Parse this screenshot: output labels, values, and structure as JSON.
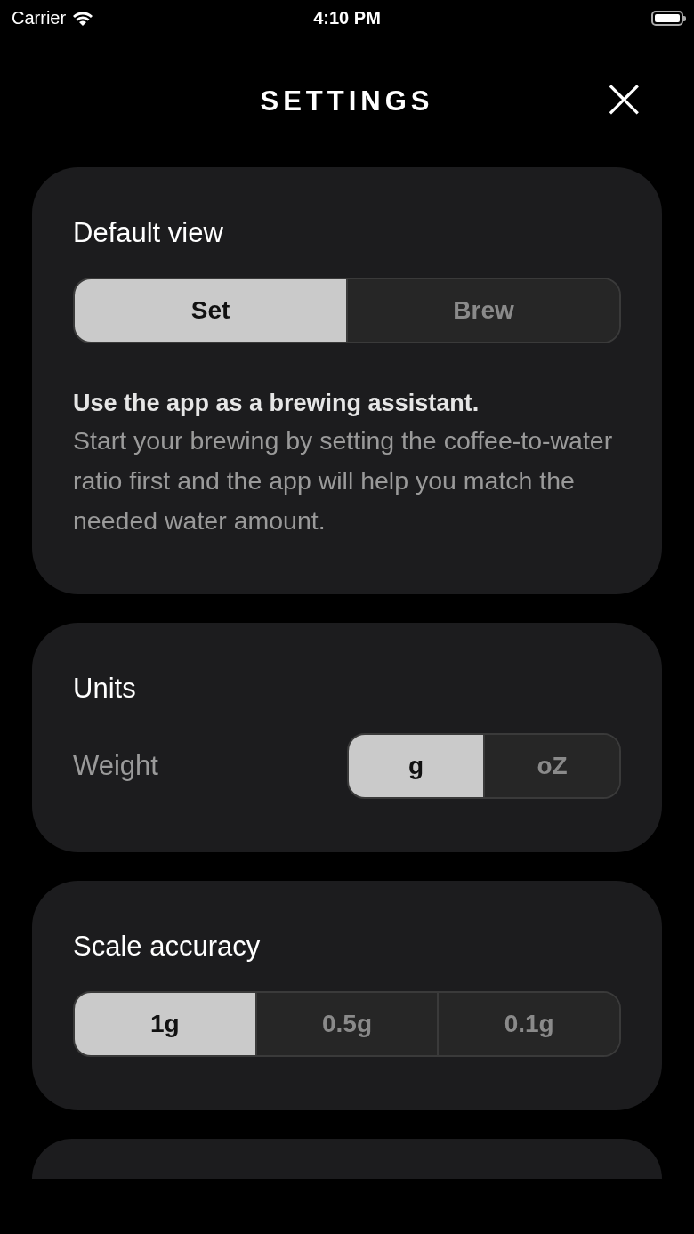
{
  "status_bar": {
    "carrier": "Carrier",
    "time": "4:10 PM"
  },
  "header": {
    "title": "SETTINGS",
    "close": "×"
  },
  "sections": [
    {
      "kind": "choice",
      "title": "Default view",
      "options": [
        {
          "label": "Set",
          "selected": true
        },
        {
          "label": "Brew",
          "selected": false
        }
      ],
      "description_title": "Use the app as a brewing assistant.",
      "description": "Start your brewing by setting the coffee-to-water ratio first and the app will help you match the needed water amount."
    },
    {
      "kind": "units",
      "title": "Units",
      "row_label": "Weight",
      "options": [
        {
          "label": "g",
          "selected": true
        },
        {
          "label": "oZ",
          "selected": false
        }
      ]
    },
    {
      "kind": "choice",
      "title": "Scale accuracy",
      "options": [
        {
          "label": "1g",
          "selected": true
        },
        {
          "label": "0.5g",
          "selected": false
        },
        {
          "label": "0.1g",
          "selected": false
        }
      ]
    },
    {
      "kind": "partial"
    }
  ]
}
